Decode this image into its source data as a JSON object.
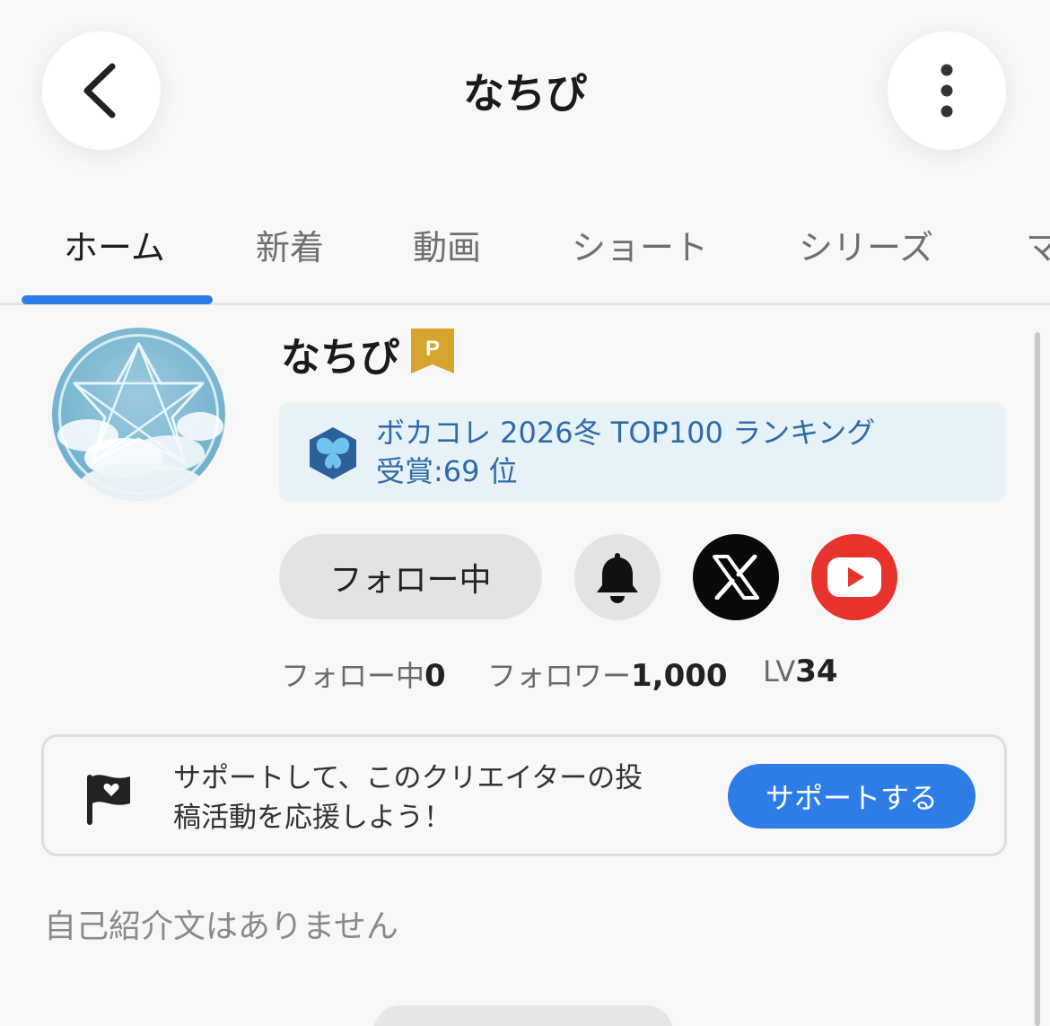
{
  "header": {
    "title": "なちぴ",
    "back_icon": "chevron-left-icon",
    "more_icon": "more-vertical-icon"
  },
  "tabs": [
    {
      "label": "ホーム",
      "active": true
    },
    {
      "label": "新着",
      "active": false
    },
    {
      "label": "動画",
      "active": false
    },
    {
      "label": "ショート",
      "active": false
    },
    {
      "label": "シリーズ",
      "active": false
    },
    {
      "label": "マ",
      "active": false
    }
  ],
  "profile": {
    "name": "なちぴ",
    "badge": "P",
    "award": {
      "line1": "ボカコレ 2026冬 TOP100 ランキング",
      "line2": "受賞:69 位"
    },
    "follow_button": "フォロー中",
    "stats": {
      "following_label": "フォロー中",
      "following_value": "0",
      "followers_label": "フォロワー",
      "followers_value": "1,000",
      "level_label": "LV",
      "level_value": "34"
    }
  },
  "support": {
    "text_line1": "サポートして、このクリエイターの投",
    "text_line2": "稿活動を応援しよう！",
    "button": "サポートする"
  },
  "bio": "自己紹介文はありません",
  "colors": {
    "accent": "#2e7de6",
    "badge": "#d4a52a",
    "award_bg": "#e6f1f8",
    "award_text": "#2f6aa8",
    "youtube": "#e8322c"
  }
}
